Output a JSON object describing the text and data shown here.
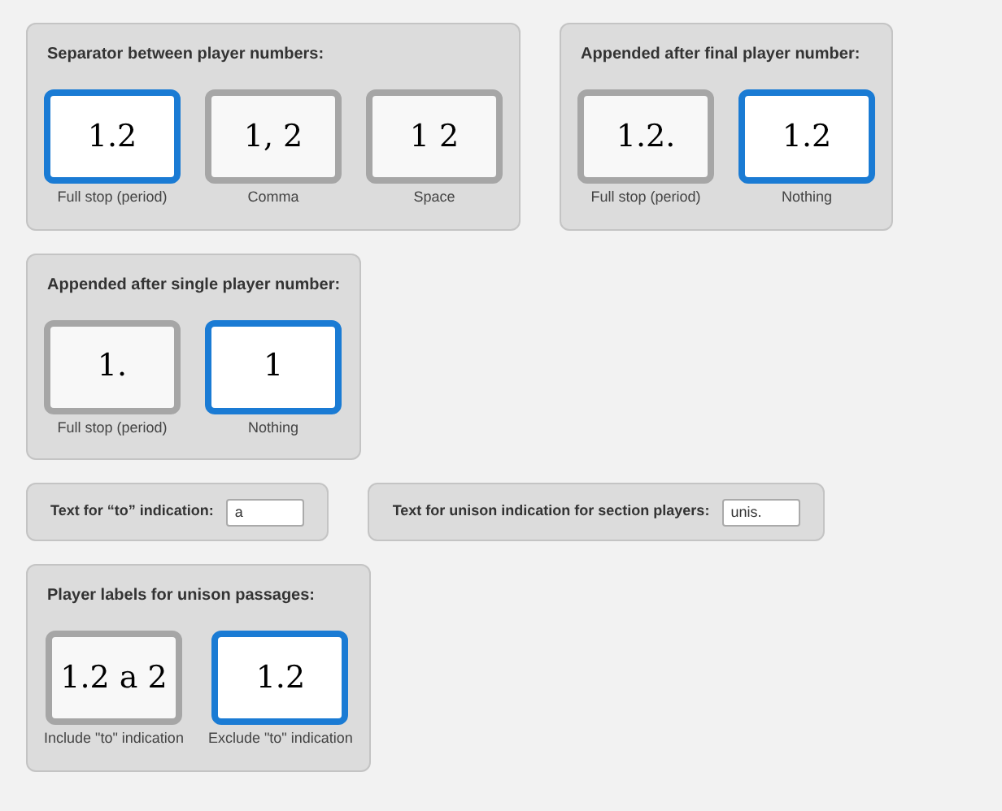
{
  "rows": [
    {
      "groups": [
        {
          "kind": "choice",
          "title": "Separator between player numbers:",
          "options": [
            {
              "preview": "1.2",
              "label": "Full stop (period)",
              "selected": true
            },
            {
              "preview": "1, 2",
              "label": "Comma",
              "selected": false
            },
            {
              "preview": "1 2",
              "label": "Space",
              "selected": false
            }
          ]
        },
        {
          "kind": "choice",
          "title": "Appended after final player number:",
          "options": [
            {
              "preview": "1.2.",
              "label": "Full stop (period)",
              "selected": false
            },
            {
              "preview": "1.2",
              "label": "Nothing",
              "selected": true
            }
          ]
        }
      ]
    },
    {
      "groups": [
        {
          "kind": "choice",
          "title": "Appended after single player number:",
          "options": [
            {
              "preview": "1.",
              "label": "Full stop (period)",
              "selected": false
            },
            {
              "preview": "1",
              "label": "Nothing",
              "selected": true
            }
          ]
        }
      ]
    },
    {
      "groups": [
        {
          "kind": "text",
          "label": "Text for “to” indication:",
          "value": "a"
        },
        {
          "kind": "text",
          "label": "Text for unison indication for section players:",
          "value": "unis."
        }
      ]
    },
    {
      "groups": [
        {
          "kind": "choice",
          "title": "Player labels for unison passages:",
          "options": [
            {
              "preview": "1.2 a 2",
              "label": "Include \"to\" indication",
              "selected": false
            },
            {
              "preview": "1.2",
              "label": "Exclude \"to\" indication",
              "selected": true
            }
          ]
        }
      ]
    }
  ]
}
